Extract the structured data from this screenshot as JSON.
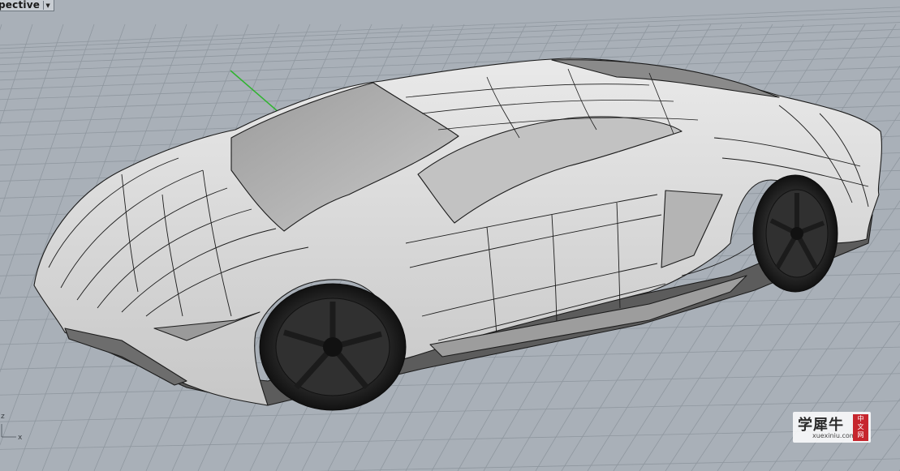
{
  "viewport": {
    "title": "pective",
    "dropdown_icon": "chevron-down-icon",
    "background_color": "#a9b0b8",
    "grid_color": "#8f979f",
    "axis_y_color": "#2fb42f",
    "axis_x_color": "#c03030"
  },
  "axes": {
    "x_label": "x",
    "z_label": "z"
  },
  "watermark": {
    "chinese_text": "学犀牛",
    "seal_text": "中文网",
    "url_text": "xuexiniu.com"
  },
  "model": {
    "object": "sports-car-nurbs-model",
    "display_mode": "shaded-with-isocurves"
  }
}
